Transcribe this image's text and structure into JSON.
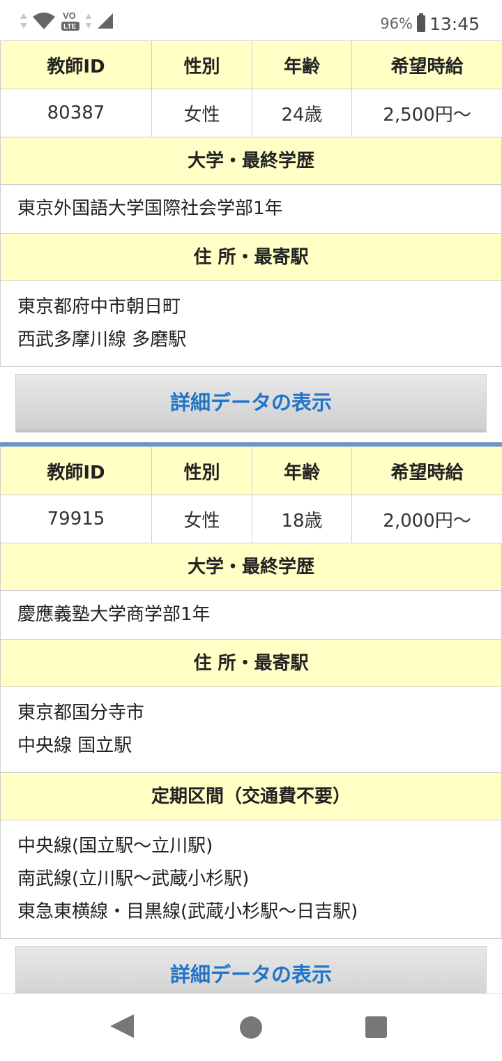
{
  "status_bar": {
    "battery_percent": "96%",
    "clock": "13:45",
    "network_badge_top": "VO",
    "network_badge_bottom": "LTE",
    "icons": [
      "data-arrows-icon",
      "wifi-icon",
      "volte-icon",
      "signal-icon",
      "battery-icon"
    ]
  },
  "teachers": [
    {
      "headers": {
        "id": "教師ID",
        "gender": "性別",
        "age": "年齢",
        "wage": "希望時給"
      },
      "id": "80387",
      "gender": "女性",
      "age": "24歳",
      "wage": "2,500円〜",
      "education_header": "大学・最終学歴",
      "education": "東京外国語大学国際社会学部1年",
      "address_header": "住 所・最寄駅",
      "address_line1": "東京都府中市朝日町",
      "address_line2": "西武多摩川線 多磨駅",
      "detail_button": "詳細データの表示"
    },
    {
      "headers": {
        "id": "教師ID",
        "gender": "性別",
        "age": "年齢",
        "wage": "希望時給"
      },
      "id": "79915",
      "gender": "女性",
      "age": "18歳",
      "wage": "2,000円〜",
      "education_header": "大学・最終学歴",
      "education": "慶應義塾大学商学部1年",
      "address_header": "住 所・最寄駅",
      "address_line1": "東京都国分寺市",
      "address_line2": "中央線 国立駅",
      "commute_header": "定期区間（交通費不要）",
      "commute_lines": [
        "中央線(国立駅〜立川駅)",
        "南武線(立川駅〜武蔵小杉駅)",
        "東急東横線・目黒線(武蔵小杉駅〜日吉駅)"
      ],
      "detail_button": "詳細データの表示"
    }
  ],
  "nav_bar": {
    "icons": [
      "back-icon",
      "home-icon",
      "recents-icon"
    ]
  }
}
